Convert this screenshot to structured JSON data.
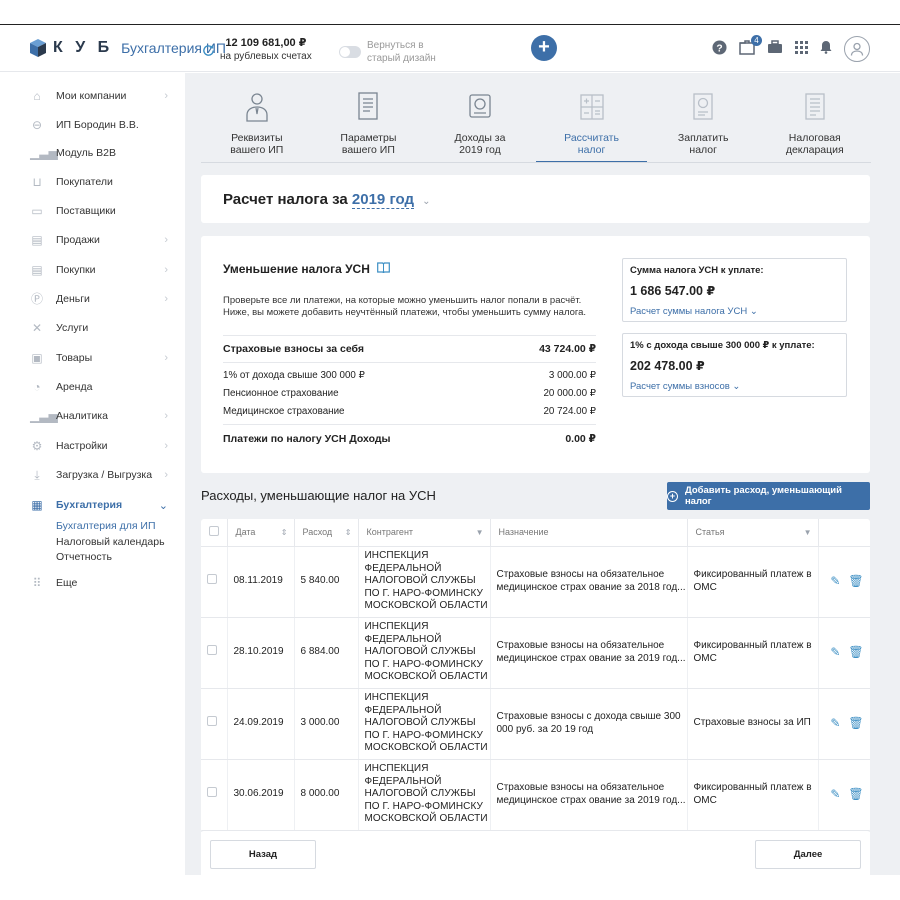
{
  "header": {
    "brand": "К У Б",
    "product": "Бухгалтерия ИП",
    "balance_amount": "12 109 681,00 ₽",
    "balance_label": "на рублевых счетах",
    "toggle_line1": "Вернуться в",
    "toggle_line2": "старый дизайн",
    "plus_label": "+",
    "notifications_count": "4",
    "accent_color": "#3d6fa8"
  },
  "sidebar": {
    "items": [
      {
        "label": "Мои компании",
        "icon": "home-icon",
        "chev": true
      },
      {
        "label": "ИП Бородин В.В.",
        "icon": "minus-circle-icon",
        "chev": false
      },
      {
        "label": "Модуль B2B",
        "icon": "chart-icon",
        "chev": false
      },
      {
        "label": "Покупатели",
        "icon": "cart-icon",
        "chev": false
      },
      {
        "label": "Поставщики",
        "icon": "truck-icon",
        "chev": false
      },
      {
        "label": "Продажи",
        "icon": "doc-icon",
        "chev": true
      },
      {
        "label": "Покупки",
        "icon": "doc-icon",
        "chev": true
      },
      {
        "label": "Деньги",
        "icon": "coin-icon",
        "chev": true
      },
      {
        "label": "Услуги",
        "icon": "tools-icon",
        "chev": false
      },
      {
        "label": "Товары",
        "icon": "box-icon",
        "chev": true
      },
      {
        "label": "Аренда",
        "icon": "key-icon",
        "chev": false
      },
      {
        "label": "Аналитика",
        "icon": "analytics-icon",
        "chev": true
      },
      {
        "label": "Настройки",
        "icon": "gear-icon",
        "chev": true
      },
      {
        "label": "Загрузка / Выгрузка",
        "icon": "download-icon",
        "chev": true
      },
      {
        "label": "Бухгалтерия",
        "icon": "calculator-icon",
        "chev": true
      }
    ],
    "sub_items": [
      "Бухгалтерия для ИП",
      "Налоговый календарь",
      "Отчетность"
    ],
    "more": "Еще"
  },
  "steps": [
    {
      "line1": "Реквизиты",
      "line2": "вашего ИП"
    },
    {
      "line1": "Параметры",
      "line2": "вашего ИП"
    },
    {
      "line1": "Доходы за",
      "line2": "2019 год"
    },
    {
      "line1": "Рассчитать",
      "line2": "налог"
    },
    {
      "line1": "Заплатить",
      "line2": "налог"
    },
    {
      "line1": "Налоговая",
      "line2": "декларация"
    }
  ],
  "title": {
    "prefix": "Расчет налога за",
    "year": "2019 год"
  },
  "calc": {
    "heading": "Уменьшение налога УСН",
    "desc": "Проверьте все ли платежи, на которые можно уменьшить налог попали в расчёт. Ниже, вы можете добавить неучтённый платежи, чтобы уменьшить сумму налога.",
    "rows": [
      {
        "label": "Страховые взносы за себя",
        "value": "43 724.00 ₽"
      },
      {
        "label": "1% от дохода свыше 300 000 ₽",
        "value": "3 000.00 ₽"
      },
      {
        "label": "Пенсионное страхование",
        "value": "20 000.00 ₽"
      },
      {
        "label": "Медицинское страхование",
        "value": "20 724.00 ₽"
      },
      {
        "label": "Платежи по налогу УСН Доходы",
        "value": "0.00 ₽"
      }
    ],
    "box1": {
      "label": "Сумма налога УСН к уплате:",
      "value": "1 686 547.00 ₽",
      "link": "Расчет суммы налога УСН ⌄"
    },
    "box2": {
      "label": "1% с дохода свыше 300 000 ₽ к уплате:",
      "value": "202 478.00 ₽",
      "link": "Расчет суммы взносов ⌄"
    }
  },
  "expenses": {
    "title": "Расходы, уменьшающие налог на УСН",
    "add_button": "Добавить расход, уменьшающий налог",
    "columns": [
      "Дата",
      "Расход",
      "Контрагент",
      "Назначение",
      "Статья"
    ],
    "rows": [
      {
        "date": "08.11.2019",
        "amount": "5 840.00",
        "contractor": "ИНСПЕКЦИЯ ФЕДЕРАЛЬНОЙ НАЛОГОВОЙ СЛУЖБЫ ПО Г. НАРО-ФОМИНСКУ МОСКОВСКОЙ ОБЛАСТИ",
        "purpose": "Страховые взносы на обязательное медицинское страх ование за 2018 год...",
        "article": "Фиксированный платеж в ОМС"
      },
      {
        "date": "28.10.2019",
        "amount": "6 884.00",
        "contractor": "ИНСПЕКЦИЯ ФЕДЕРАЛЬНОЙ НАЛОГОВОЙ СЛУЖБЫ ПО Г. НАРО-ФОМИНСКУ МОСКОВСКОЙ ОБЛАСТИ",
        "purpose": "Страховые взносы на обязательное медицинское страх ование за 2019 год...",
        "article": "Фиксированный платеж в ОМС"
      },
      {
        "date": "24.09.2019",
        "amount": "3 000.00",
        "contractor": "ИНСПЕКЦИЯ ФЕДЕРАЛЬНОЙ НАЛОГОВОЙ СЛУЖБЫ ПО Г. НАРО-ФОМИНСКУ МОСКОВСКОЙ ОБЛАСТИ",
        "purpose": "Страховые взносы с дохода свыше 300 000 руб. за 20 19 год",
        "article": "Страховые взносы за ИП"
      },
      {
        "date": "30.06.2019",
        "amount": "8 000.00",
        "contractor": "ИНСПЕКЦИЯ ФЕДЕРАЛЬНОЙ НАЛОГОВОЙ СЛУЖБЫ ПО Г. НАРО-ФОМИНСКУ МОСКОВСКОЙ ОБЛАСТИ",
        "purpose": "Страховые взносы на обязательное медицинское страх ование за 2019 год...",
        "article": "Фиксированный платеж в ОМС"
      }
    ]
  },
  "nav": {
    "back": "Назад",
    "next": "Далее"
  }
}
